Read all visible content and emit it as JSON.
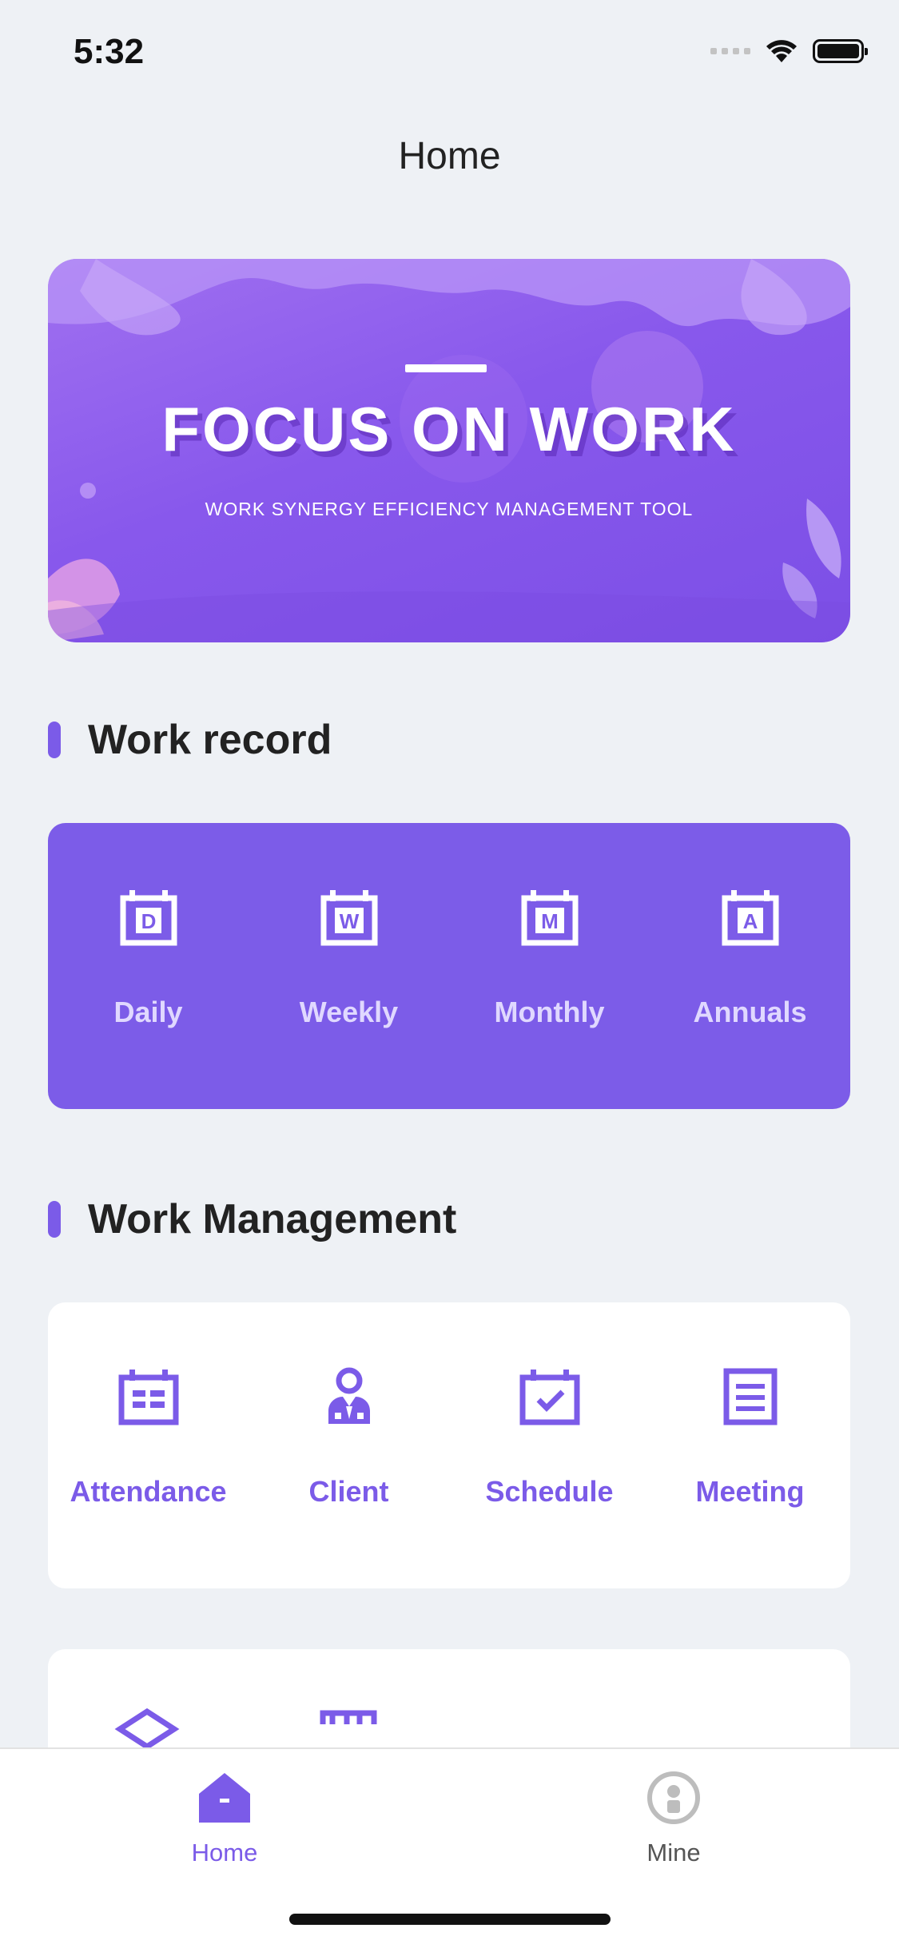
{
  "status_bar": {
    "time": "5:32"
  },
  "nav": {
    "title": "Home"
  },
  "banner": {
    "title": "FOCUS ON WORK",
    "subtitle": "WORK SYNERGY EFFICIENCY MANAGEMENT TOOL"
  },
  "work_record": {
    "title": "Work record",
    "items": [
      {
        "label": "Daily",
        "icon": "calendar-d-icon"
      },
      {
        "label": "Weekly",
        "icon": "calendar-w-icon"
      },
      {
        "label": "Monthly",
        "icon": "calendar-m-icon"
      },
      {
        "label": "Annuals",
        "icon": "calendar-a-icon"
      }
    ]
  },
  "work_management": {
    "title": "Work Management",
    "items": [
      {
        "label": "Attendance",
        "icon": "attendance-icon"
      },
      {
        "label": "Client",
        "icon": "client-icon"
      },
      {
        "label": "Schedule",
        "icon": "schedule-icon"
      },
      {
        "label": "Meeting",
        "icon": "meeting-icon"
      }
    ]
  },
  "tabbar": {
    "items": [
      {
        "label": "Home",
        "icon": "home-icon",
        "active": true
      },
      {
        "label": "Mine",
        "icon": "user-icon",
        "active": false
      }
    ]
  },
  "colors": {
    "accent": "#7b5be8",
    "background": "#eef1f5",
    "card": "#ffffff"
  }
}
